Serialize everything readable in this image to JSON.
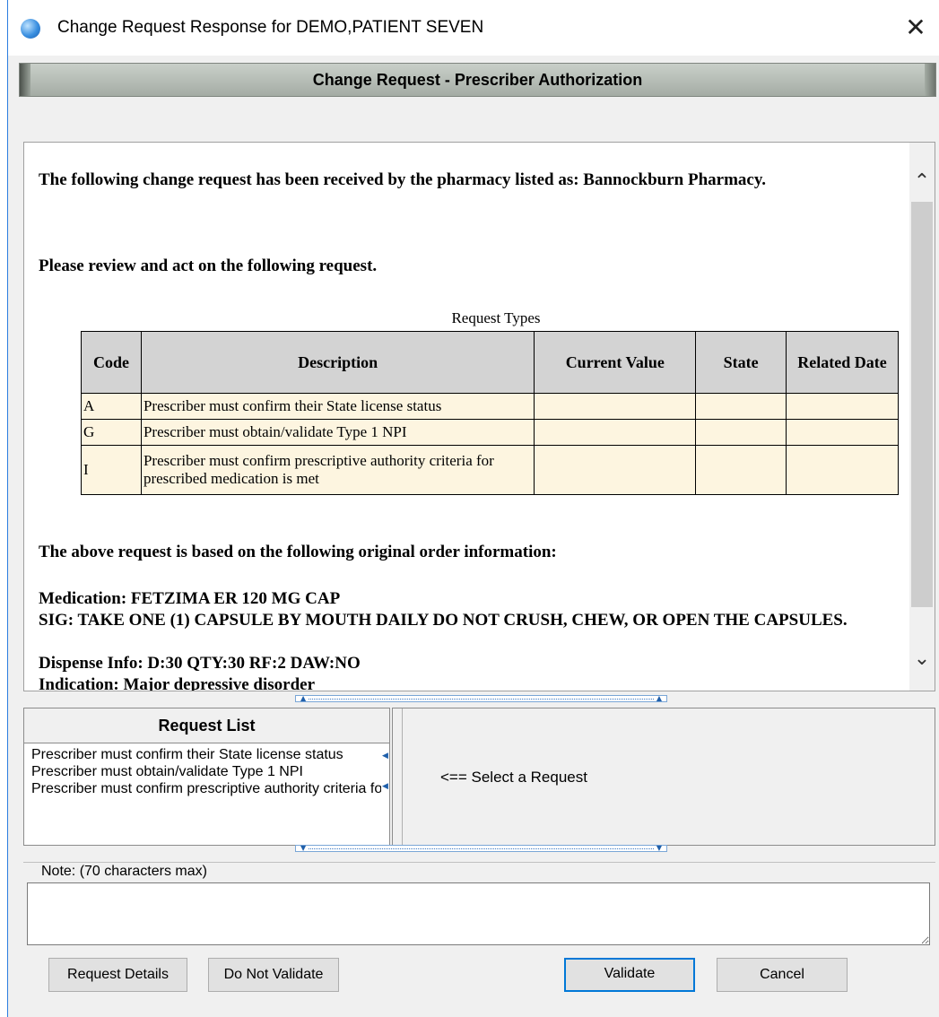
{
  "window": {
    "title": "Change Request Response for DEMO,PATIENT SEVEN",
    "close_glyph": "✕"
  },
  "header": {
    "title": "Change Request - Prescriber Authorization"
  },
  "content": {
    "intro": "The following change request has been received by the pharmacy listed as: Bannockburn Pharmacy.",
    "instruction": "Please review and act on the following request.",
    "table": {
      "caption": "Request Types",
      "columns": [
        "Code",
        "Description",
        "Current Value",
        "State",
        "Related Date"
      ],
      "rows": [
        {
          "code": "A",
          "description": "Prescriber must confirm their State license status",
          "current_value": "",
          "state": "",
          "related_date": ""
        },
        {
          "code": "G",
          "description": "Prescriber must obtain/validate Type 1 NPI",
          "current_value": "",
          "state": "",
          "related_date": ""
        },
        {
          "code": "I",
          "description": "Prescriber must confirm prescriptive authority criteria for prescribed medication is met",
          "current_value": "",
          "state": "",
          "related_date": ""
        }
      ]
    },
    "basis": "The above request is based on the following original order information:",
    "medication": "Medication: FETZIMA ER 120 MG CAP",
    "sig": "SIG: TAKE ONE (1) CAPSULE BY MOUTH DAILY DO NOT CRUSH, CHEW, OR OPEN THE CAPSULES.",
    "dispense": "Dispense Info: D:30 QTY:30 RF:2 DAW:NO",
    "indication": "Indication: Major depressive disorder"
  },
  "request_list": {
    "header": "Request List",
    "items": [
      "Prescriber must confirm their State license status",
      "Prescriber must obtain/validate Type 1 NPI",
      "Prescriber must confirm prescriptive authority criteria for prescribed medication is met"
    ]
  },
  "detail": {
    "hint": "<== Select a Request"
  },
  "note": {
    "label": "Note: (70 characters max)",
    "value": ""
  },
  "buttons": {
    "request_details": "Request Details",
    "do_not_validate": "Do Not Validate",
    "validate": "Validate",
    "cancel": "Cancel"
  },
  "colors": {
    "table_row_bg": "#fdf5e0",
    "table_header_bg": "#d3d3d3",
    "accent": "#0078d7"
  }
}
